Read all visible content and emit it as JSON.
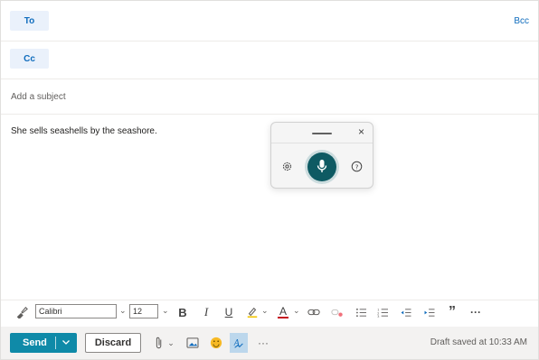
{
  "recipients": {
    "to_label": "To",
    "cc_label": "Cc",
    "bcc_label": "Bcc"
  },
  "subject": {
    "placeholder": "Add a subject"
  },
  "body": {
    "text": "She sells seashells by the seashore."
  },
  "dictation": {
    "close_glyph": "×",
    "icons": [
      "drag-handle-icon",
      "close-icon",
      "gear-icon",
      "microphone-icon",
      "help-icon"
    ]
  },
  "format_toolbar": {
    "font_name": "Calibri",
    "font_size": "12",
    "bold_glyph": "B",
    "italic_glyph": "I",
    "underline_glyph": "U",
    "font_color_glyph": "A",
    "quote_glyph": "”",
    "more_glyph": "···",
    "icons": [
      "format-painter-icon",
      "highlight-icon",
      "font-color-icon",
      "link-icon",
      "unlink-icon",
      "bullets-icon",
      "numbering-icon",
      "outdent-icon",
      "indent-icon",
      "quote-icon",
      "more-icon"
    ]
  },
  "actions": {
    "send_label": "Send",
    "discard_label": "Discard",
    "more_glyph": "···",
    "draft_status": "Draft saved at 10:33 AM",
    "icons": [
      "attach-icon",
      "image-icon",
      "emoji-icon",
      "editor-icon",
      "more-icon"
    ]
  },
  "colors": {
    "accent": "#0f6cbd",
    "send_bg": "#0f8aa8",
    "mic_bg": "#0e5a63",
    "pill_bg": "#eaf1fb"
  }
}
